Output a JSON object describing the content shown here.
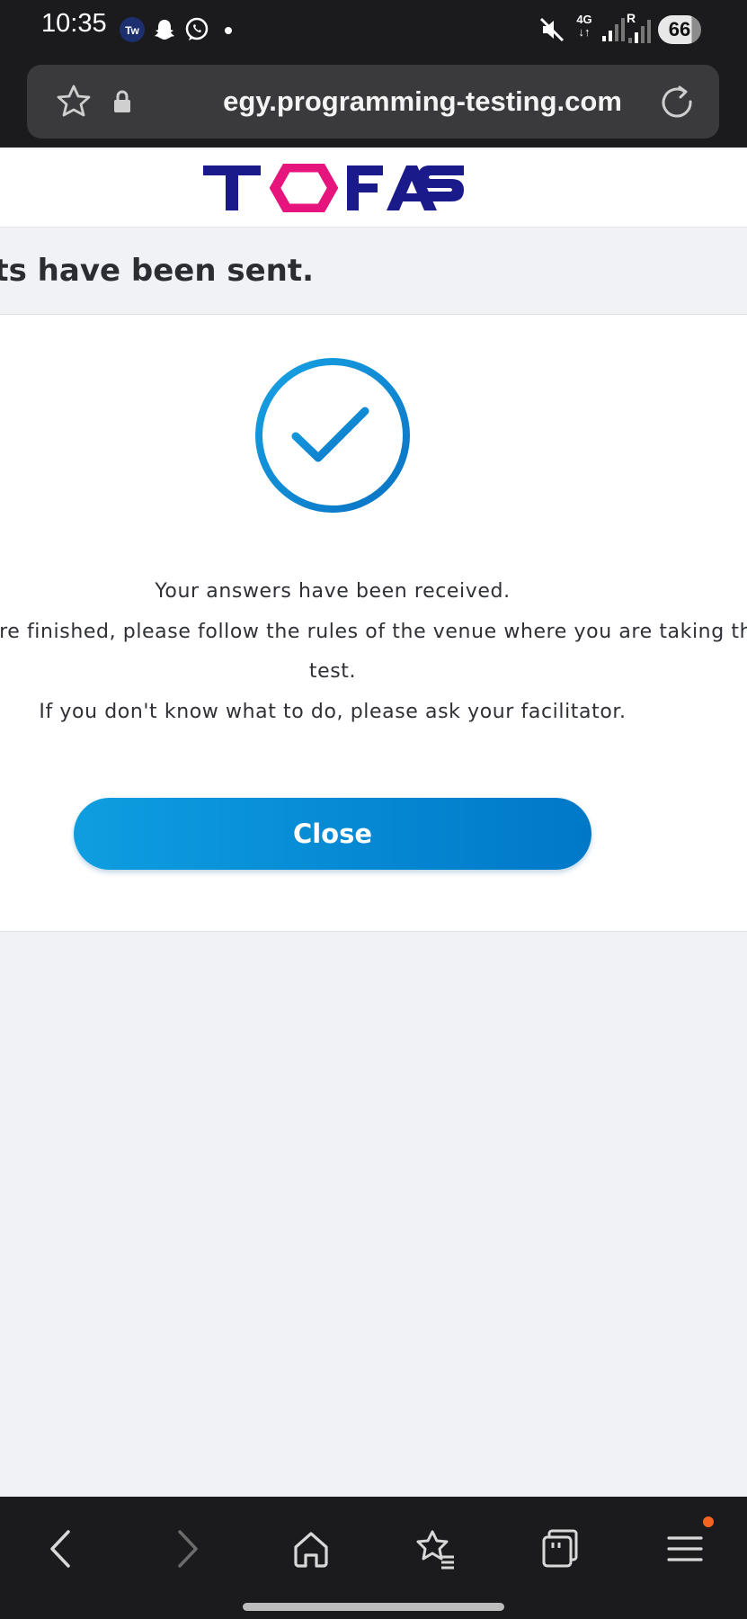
{
  "status_bar": {
    "time": "10:35",
    "app_icons": [
      "twitch-like-icon",
      "snapchat-icon",
      "whatsapp-icon",
      "dot-icon"
    ],
    "network": "4G",
    "signal_sim2": "R",
    "battery": "66"
  },
  "browser": {
    "url": "egy.programming-testing.com",
    "icons": {
      "bookmark": "star-icon",
      "secure": "lock-icon",
      "reload": "reload-icon"
    }
  },
  "site": {
    "logo_text": "TOFAS",
    "colors": {
      "logo_blue": "#1b1a8a",
      "logo_pink": "#e5157d",
      "accent": "#0f88d2"
    }
  },
  "page": {
    "title": "Results have been sent.",
    "messages": {
      "line1": "Your answers have been received.",
      "line2": "When you are finished, please follow the rules of the venue where you are taking the",
      "line3": "test.",
      "line4": "If you don't know what to do, please ask your facilitator."
    },
    "close_label": "Close"
  },
  "bottom_nav": {
    "items": [
      "back-icon",
      "forward-icon",
      "home-icon",
      "bookmarks-icon",
      "tabs-icon",
      "menu-icon"
    ]
  }
}
